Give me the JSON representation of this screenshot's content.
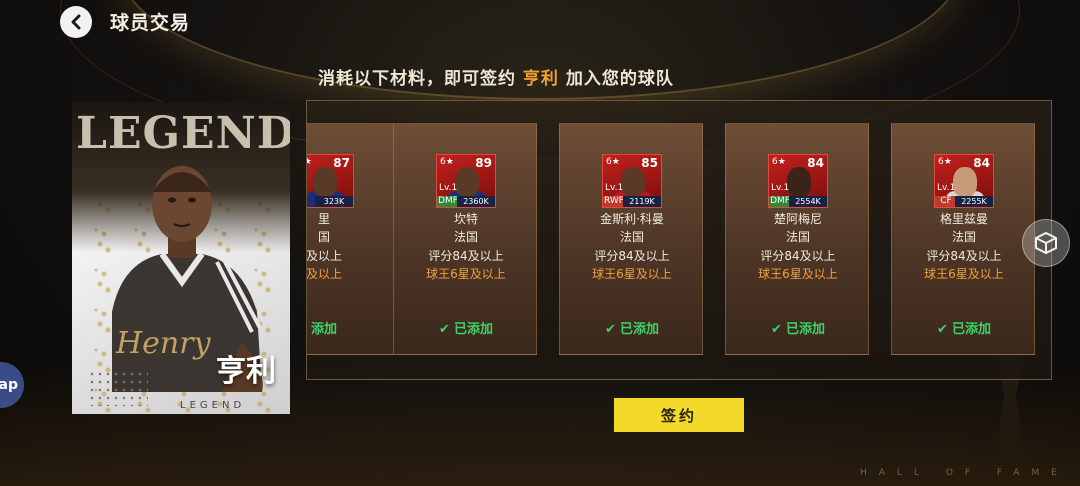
{
  "header": {
    "title": "球员交易"
  },
  "hero_card": {
    "badge_text": "LEGEND",
    "signature": "Henry",
    "name": "亨利",
    "footer": "LEGEND"
  },
  "left_edge_pill": {
    "label": "ap"
  },
  "instruction": {
    "prefix": "消耗以下材料，即可签约",
    "highlight": "亨利",
    "suffix": "加入您的球队"
  },
  "materials": [
    {
      "stars": "6★",
      "rating": "87",
      "level": "",
      "position": "",
      "value": "323K",
      "name": "里",
      "nation": "国",
      "requirement": "及以上",
      "tier": "及以上",
      "status": "添加",
      "partial": true
    },
    {
      "stars": "6★",
      "rating": "89",
      "level": "Lv.1",
      "position": "DMF",
      "value": "2360K",
      "name": "坎特",
      "nation": "法国",
      "requirement": "评分84及以上",
      "tier": "球王6星及以上",
      "status": "已添加",
      "partial": false
    },
    {
      "stars": "6★",
      "rating": "85",
      "level": "Lv.1",
      "position": "RWF",
      "value": "2119K",
      "name": "金斯利·科曼",
      "nation": "法国",
      "requirement": "评分84及以上",
      "tier": "球王6星及以上",
      "status": "已添加",
      "partial": false
    },
    {
      "stars": "6★",
      "rating": "84",
      "level": "Lv.1",
      "position": "DMF",
      "value": "2554K",
      "name": "楚阿梅尼",
      "nation": "法国",
      "requirement": "评分84及以上",
      "tier": "球王6星及以上",
      "status": "已添加",
      "partial": false
    },
    {
      "stars": "6★",
      "rating": "84",
      "level": "Lv.1",
      "position": "CF",
      "value": "2255K",
      "name": "格里兹曼",
      "nation": "法国",
      "requirement": "评分84及以上",
      "tier": "球王6星及以上",
      "status": "已添加",
      "partial": false
    }
  ],
  "sign_button": {
    "label": "签约"
  },
  "footer_watermark": "HALL OF FAME",
  "colors": {
    "accent_orange": "#f3a230",
    "added_green": "#3fd06a",
    "sign_yellow": "#f2d92a",
    "card_red": "#c2211c"
  },
  "icons": {
    "back": "chevron-left-icon",
    "added": "check-icon",
    "side_button": "cube-icon"
  }
}
